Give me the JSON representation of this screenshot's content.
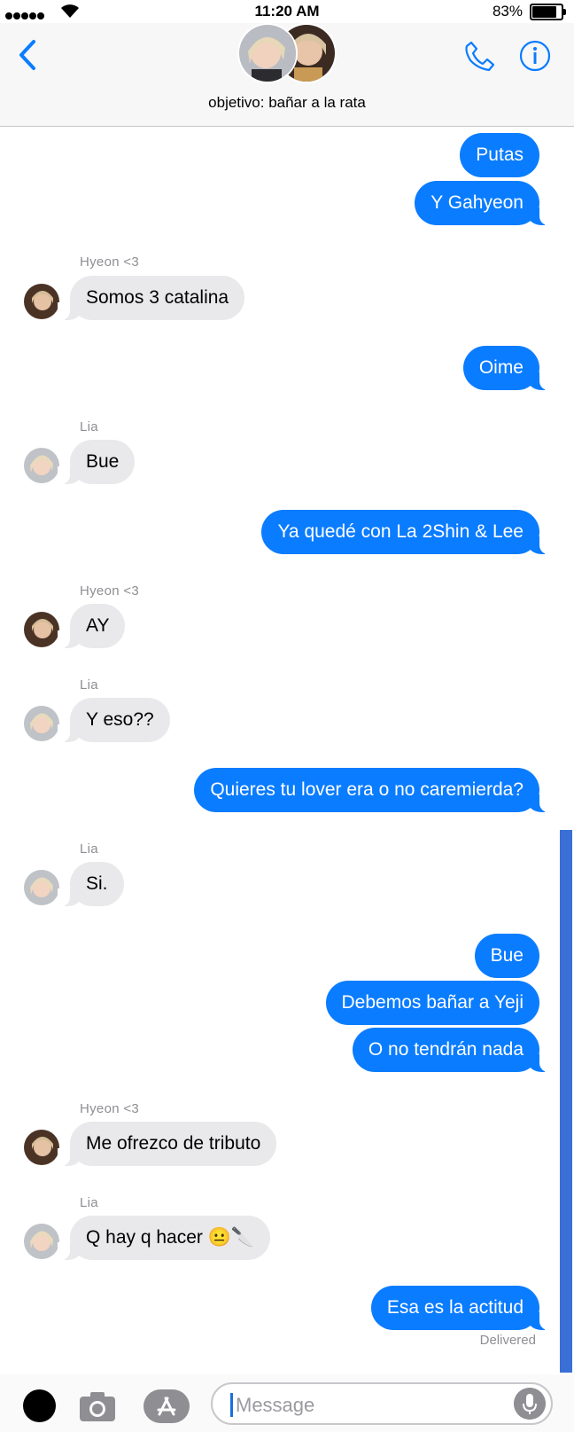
{
  "status_bar": {
    "time": "11:20 AM",
    "battery": "83%"
  },
  "header": {
    "group_name": "objetivo: bañar a la rata"
  },
  "messages": [
    {
      "from": "me",
      "text": "Putas"
    },
    {
      "from": "me",
      "text": "Y Gahyeon"
    },
    {
      "sender": "Hyeon <3",
      "text": "Somos 3 catalina"
    },
    {
      "from": "me",
      "text": "Oime"
    },
    {
      "sender": "Lia",
      "text": "Bue"
    },
    {
      "from": "me",
      "text": "Ya quedé con La 2Shin & Lee"
    },
    {
      "sender": "Hyeon <3",
      "text": "AY"
    },
    {
      "sender": "Lia",
      "text": "Y eso??"
    },
    {
      "from": "me",
      "text": "Quieres tu lover era o no caremierda?"
    },
    {
      "sender": "Lia",
      "text": "Si."
    },
    {
      "from": "me",
      "text": "Bue"
    },
    {
      "from": "me",
      "text": "Debemos bañar a Yeji"
    },
    {
      "from": "me",
      "text": "O no tendrán nada"
    },
    {
      "sender": "Hyeon <3",
      "text": "Me ofrezco de tributo"
    },
    {
      "sender": "Lia",
      "text": "Q hay q hacer 😐🔪"
    },
    {
      "from": "me",
      "text": "Esa es la actitud"
    }
  ],
  "delivered": "Delivered",
  "composer": {
    "placeholder": "Message"
  },
  "colors": {
    "accent": "#0a7cff",
    "incoming": "#e9e9eb",
    "scrollbar": "#3a6fd6"
  }
}
